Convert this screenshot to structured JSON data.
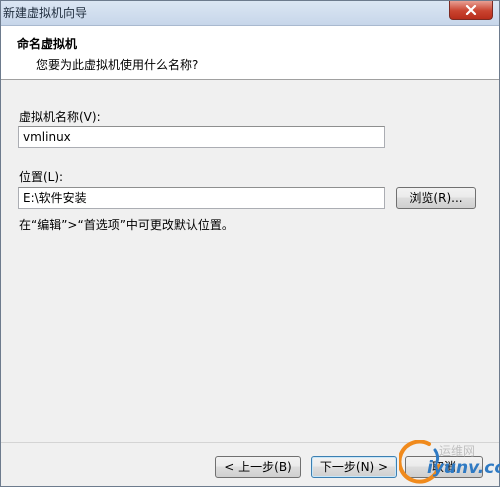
{
  "window": {
    "title": "新建虚拟机向导"
  },
  "header": {
    "title": "命名虚拟机",
    "subtitle": "您要为此虚拟机使用什么名称?"
  },
  "form": {
    "name_label": "虚拟机名称(V):",
    "name_value": "vmlinux",
    "location_label": "位置(L):",
    "location_value": "E:\\软件安装",
    "browse_label": "浏览(R)...",
    "hint": "在“编辑”>“首选项”中可更改默认位置。"
  },
  "footer": {
    "back_label": "< 上一步(B)",
    "next_label": "下一步(N) >",
    "cancel_label": "取消"
  },
  "watermark": {
    "text": "运维网",
    "sub": "iyunv.com"
  },
  "icons": {
    "close": "close-icon"
  },
  "colors": {
    "close_button": "#c9432f",
    "titlebar": "#c7d6ea",
    "dialog_bg": "#f0f0f0",
    "watermark_blue": "#2f7ac3"
  }
}
